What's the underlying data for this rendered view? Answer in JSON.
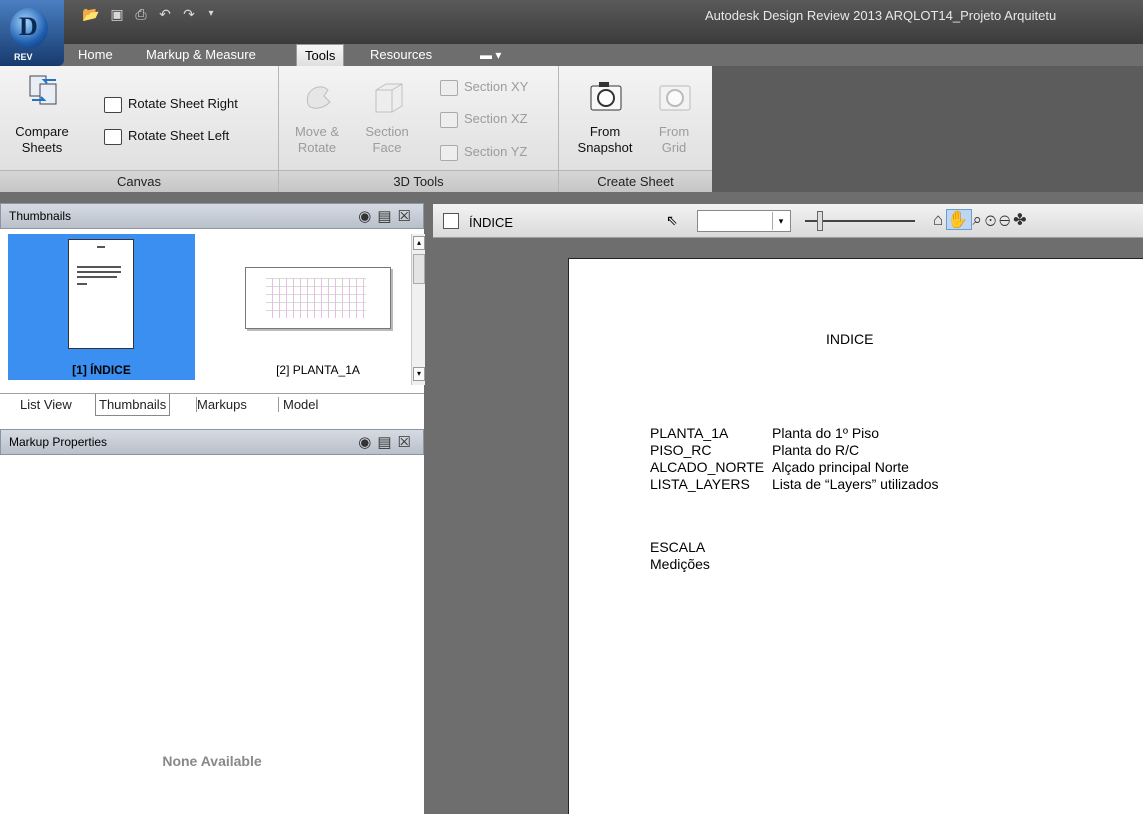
{
  "window": {
    "title": "Autodesk Design Review 2013   ARQLOT14_Projeto Arquitetu",
    "app_badge": "REV"
  },
  "tabs": [
    "Home",
    "Markup & Measure",
    "Tools",
    "Resources",
    "▬ ▾"
  ],
  "ribbon": {
    "canvas": {
      "label": "Canvas",
      "compare": "Compare\nSheets",
      "rotate_right": "Rotate Sheet Right",
      "rotate_left": "Rotate Sheet Left"
    },
    "tools3d": {
      "label": "3D Tools",
      "move_rotate": "Move &\nRotate",
      "section_face": "Section\nFace",
      "section_xy": "Section XY",
      "section_xz": "Section XZ",
      "section_yz": "Section YZ"
    },
    "create_sheet": {
      "label": "Create Sheet",
      "from_snapshot": "From\nSnapshot",
      "from_grid": "From\nGrid"
    }
  },
  "thumbnails_panel": {
    "title": "Thumbnails",
    "items": [
      {
        "label": "[1] ÍNDICE",
        "selected": true
      },
      {
        "label": "[2] PLANTA_1A",
        "selected": false
      }
    ],
    "view_tabs": [
      "List View",
      "Thumbnails",
      "Markups",
      "Model"
    ],
    "active_view_tab": "Thumbnails"
  },
  "markup_properties": {
    "title": "Markup Properties",
    "empty_text": "None Available"
  },
  "document": {
    "tab_title": "ÍNDICE",
    "heading": "INDICE",
    "entries": [
      {
        "name": "PLANTA_1A",
        "desc": "Planta do 1º Piso"
      },
      {
        "name": "PISO_RC",
        "desc": "Planta do R/C"
      },
      {
        "name": "ALCADO_NORTE",
        "desc": "Alçado principal Norte"
      },
      {
        "name": "LISTA_LAYERS",
        "desc": "Lista de “Layers” utilizados"
      }
    ],
    "footer_lines": [
      "ESCALA",
      "Medições"
    ]
  },
  "colors": {
    "selection_blue": "#3b8ff0",
    "titlebar": "#3b3b3b",
    "canvas_gray": "#6e6e6e"
  }
}
